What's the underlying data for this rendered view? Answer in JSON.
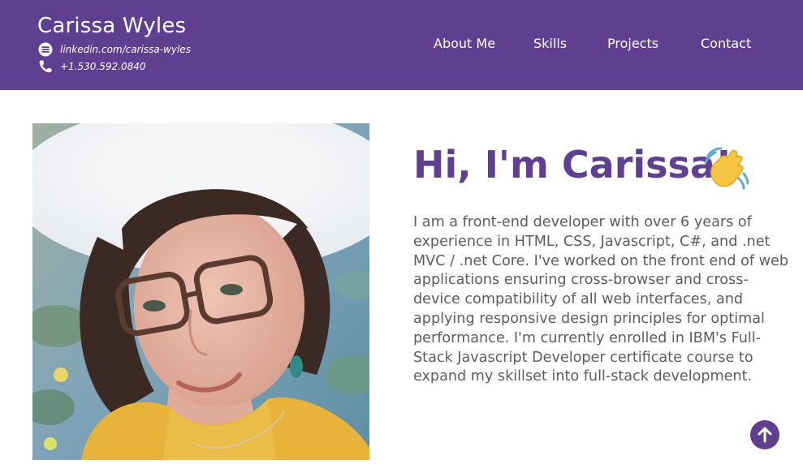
{
  "header": {
    "name": "Carissa Wyles",
    "linkedin": "linkedin.com/carissa-wyles",
    "phone": "+1.530.592.0840",
    "linkedin_icon": "linkedin-icon",
    "phone_icon": "phone-icon",
    "background": "#5f3f8f"
  },
  "nav": {
    "items": [
      "About Me",
      "Skills",
      "Projects",
      "Contact"
    ]
  },
  "hero": {
    "headline": "Hi, I'm Carissa!",
    "headline_icon": "waving-hand-icon",
    "bio": "I am a front-end developer with over 6 years of experience in HTML, CSS, Javascript, C#, and .net MVC / .net Core. I've worked on the front end of web applications ensuring cross-browser and cross-device compatibility of all web interfaces, and applying responsive design principles for optimal performance. I'm currently enrolled in IBM's Full-Stack Javascript Developer certificate course to expand my skillset into full-stack development.",
    "accent": "#5f3f8f",
    "text_color": "#5d5d5d"
  },
  "back_to_top_icon": "arrow-up-icon"
}
